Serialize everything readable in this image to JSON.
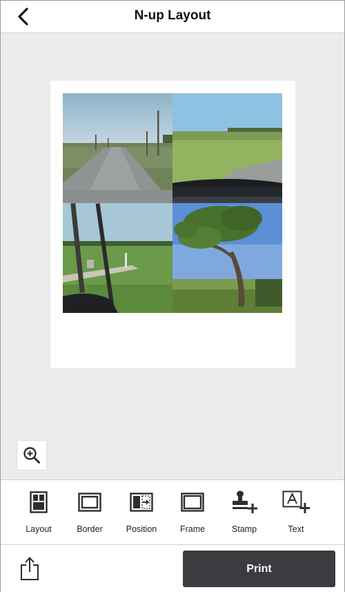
{
  "header": {
    "title": "N-up Layout",
    "back_icon": "chevron-left-icon"
  },
  "preview": {
    "layout": "2x2",
    "photos": [
      {
        "name": "photo-country-road"
      },
      {
        "name": "photo-field-from-car"
      },
      {
        "name": "photo-utility-pole-field"
      },
      {
        "name": "photo-tree-sky"
      }
    ],
    "zoom_icon": "zoom-in-icon"
  },
  "toolbar": {
    "items": [
      {
        "label": "Layout",
        "icon": "layout-icon"
      },
      {
        "label": "Border",
        "icon": "border-icon"
      },
      {
        "label": "Position",
        "icon": "position-icon"
      },
      {
        "label": "Frame",
        "icon": "frame-icon"
      },
      {
        "label": "Stamp",
        "icon": "stamp-icon"
      },
      {
        "label": "Text",
        "icon": "text-icon"
      }
    ]
  },
  "footer": {
    "share_icon": "share-icon",
    "print_label": "Print"
  },
  "colors": {
    "canvas_background": "#ebecee",
    "print_button": "#3b3c40",
    "icon": "#2e2e30"
  }
}
